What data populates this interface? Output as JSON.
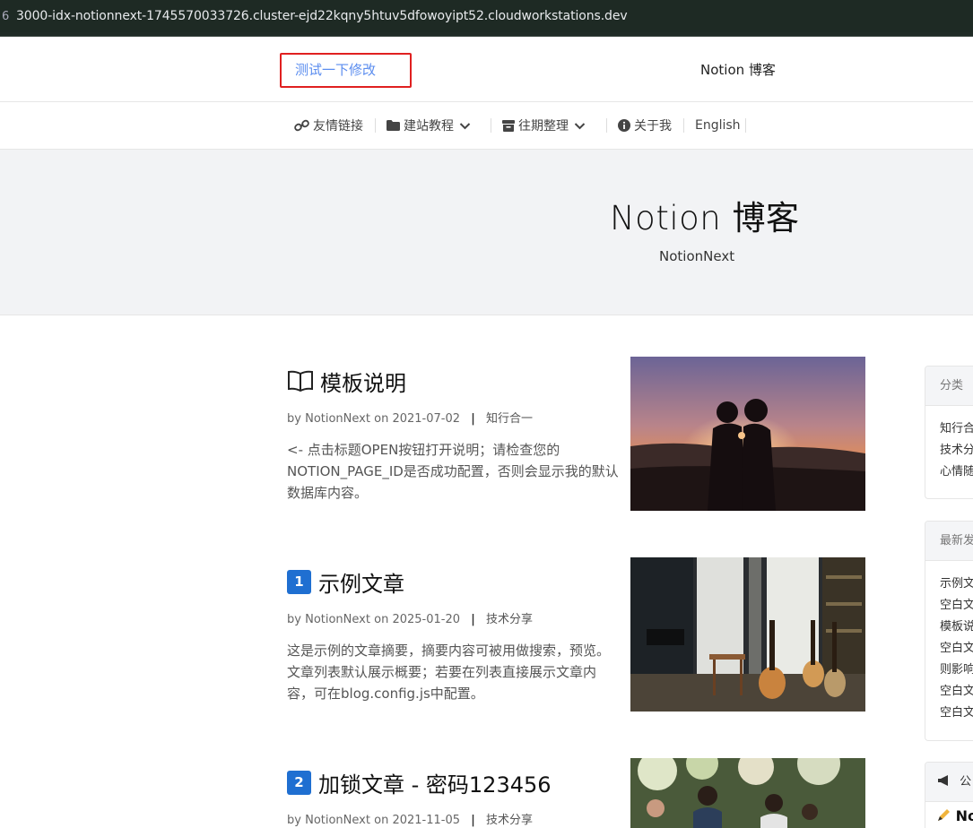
{
  "browser": {
    "url": "3000-idx-notionnext-1745570033726.cluster-ejd22kqny5htuv5dfowoyipt52.cloudworkstations.dev"
  },
  "header": {
    "top_link": "测试一下修改",
    "site_title": "Notion 博客"
  },
  "nav": {
    "items": [
      {
        "label": "友情链接",
        "icon": "link-icon"
      },
      {
        "label": "建站教程",
        "icon": "folder-icon",
        "dropdown": true
      },
      {
        "label": "往期整理",
        "icon": "archive-icon",
        "dropdown": true
      },
      {
        "label": "关于我",
        "icon": "info-icon"
      },
      {
        "label": "English"
      }
    ]
  },
  "hero": {
    "title": "Notion 博客",
    "subtitle": "NotionNext"
  },
  "posts": [
    {
      "icon": "book-icon",
      "title": "模板说明",
      "author_prefix": "by",
      "author": "NotionNext",
      "date_prefix": "on",
      "date": "2021-07-02",
      "separator": "|",
      "category": "知行合一",
      "excerpt": "<- 点击标题OPEN按钮打开说明；请检查您的NOTION_PAGE_ID是否成功配置，否则会显示我的默认数据库内容。"
    },
    {
      "icon_text": "1",
      "title": "示例文章",
      "author_prefix": "by",
      "author": "NotionNext",
      "date_prefix": "on",
      "date": "2025-01-20",
      "separator": "|",
      "category": "技术分享",
      "excerpt": "这是示例的文章摘要，摘要内容可被用做搜索，预览。文章列表默认展示概要；若要在列表直接展示文章内容，可在blog.config.js中配置。"
    },
    {
      "icon_text": "2",
      "title": "加锁文章 - 密码123456",
      "author_prefix": "by",
      "author": "NotionNext",
      "date_prefix": "on",
      "date": "2021-11-05",
      "separator": "|",
      "category": "技术分享"
    }
  ],
  "sidebar": {
    "categories": {
      "title": "分类",
      "items": [
        "知行合",
        "技术分",
        "心情随"
      ]
    },
    "latest": {
      "title": "最新发",
      "items": [
        "示例文",
        "空白文",
        "模板说",
        "空白文",
        "则影响",
        "空白文",
        "空白文"
      ]
    },
    "notice": {
      "title": "公",
      "content": "No"
    }
  }
}
